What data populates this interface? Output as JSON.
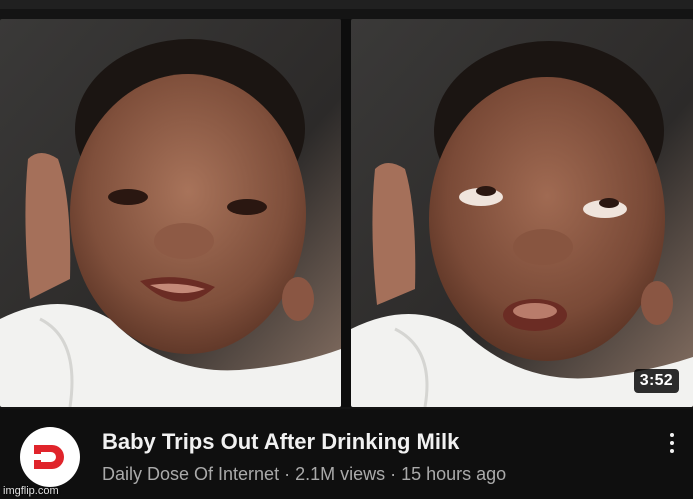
{
  "video": {
    "duration": "3:52",
    "title": "Baby Trips Out After Drinking Milk",
    "channel": "Daily Dose Of Internet",
    "views": "2.1M views",
    "age": "15 hours ago",
    "separator": "·",
    "channel_avatar_icon": "daily-dose-logo-icon",
    "more_icon": "kebab-menu-icon"
  },
  "thumbnail": {
    "left_panel": "baby-smiling",
    "right_panel": "baby-eyes-rolled"
  },
  "watermark": "imgflip.com",
  "colors": {
    "background": "#0f0f0f",
    "title_text": "#f1f1f1",
    "meta_text": "#aaaaaa",
    "brand_red": "#e0242b"
  }
}
